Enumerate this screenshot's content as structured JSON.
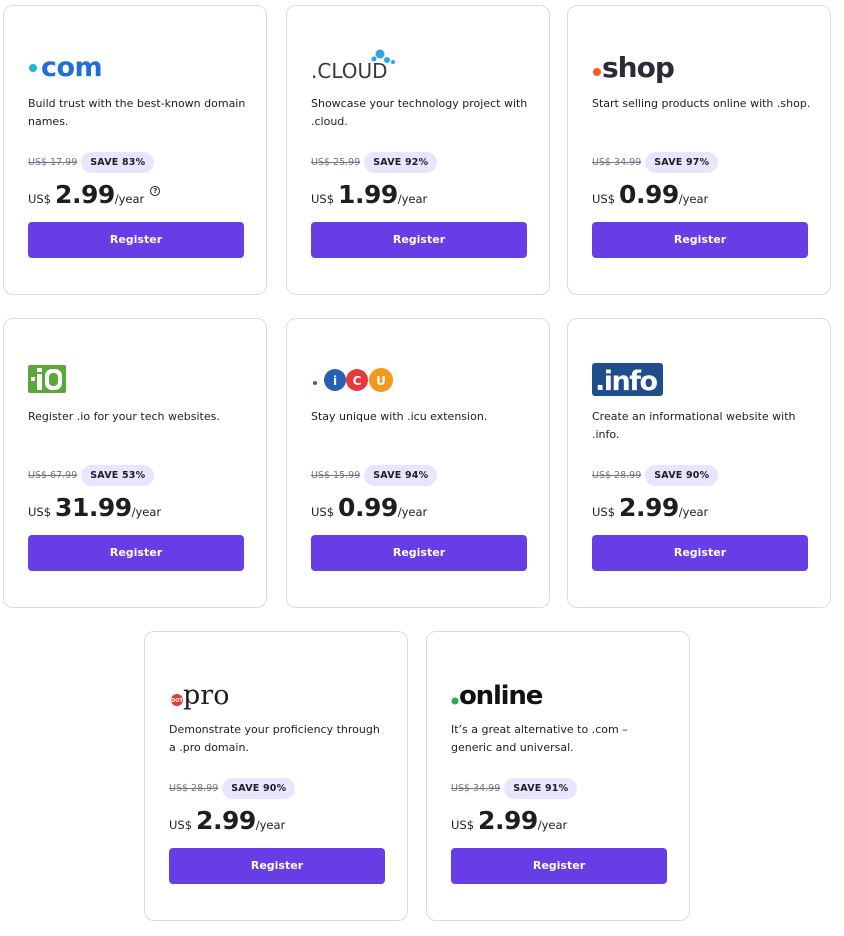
{
  "cards": [
    {
      "logo": "dot-com-logo",
      "logo_text": ".com",
      "description": "Build trust with the best-known domain names.",
      "old_price": "US$ 17.99",
      "save": "SAVE 83%",
      "currency": "US$",
      "price": "2.99",
      "period": "/year",
      "help": "?",
      "button": "Register"
    },
    {
      "logo": "dot-cloud-logo",
      "logo_text": ".CLOUD",
      "description": "Showcase your technology project with .cloud.",
      "old_price": "US$ 25.99",
      "save": "SAVE 92%",
      "currency": "US$",
      "price": "1.99",
      "period": "/year",
      "button": "Register"
    },
    {
      "logo": "dot-shop-logo",
      "logo_text": ".shop",
      "description": "Start selling products online with .shop.",
      "old_price": "US$ 34.99",
      "save": "SAVE 97%",
      "currency": "US$",
      "price": "0.99",
      "period": "/year",
      "button": "Register"
    },
    {
      "logo": "dot-io-logo",
      "logo_text": "·iO",
      "description": "Register .io for your tech websites.",
      "old_price": "US$ 67.99",
      "save": "SAVE 53%",
      "currency": "US$",
      "price": "31.99",
      "period": "/year",
      "button": "Register"
    },
    {
      "logo": "dot-icu-logo",
      "logo_text": "ICU",
      "description": "Stay unique with .icu extension.",
      "old_price": "US$ 15.99",
      "save": "SAVE 94%",
      "currency": "US$",
      "price": "0.99",
      "period": "/year",
      "button": "Register"
    },
    {
      "logo": "dot-info-logo",
      "logo_text": ".info",
      "description": "Create an informational website with .info.",
      "old_price": "US$ 28.99",
      "save": "SAVE 90%",
      "currency": "US$",
      "price": "2.99",
      "period": "/year",
      "button": "Register"
    },
    {
      "logo": "dot-pro-logo",
      "logo_text": "pro",
      "description": "Demonstrate your proficiency through a .pro domain.",
      "old_price": "US$ 28.99",
      "save": "SAVE 90%",
      "currency": "US$",
      "price": "2.99",
      "period": "/year",
      "button": "Register"
    },
    {
      "logo": "dot-online-logo",
      "logo_text": "online",
      "description": "It’s a great alternative to .com – generic and universal.",
      "old_price": "US$ 34.99",
      "save": "SAVE 91%",
      "currency": "US$",
      "price": "2.99",
      "period": "/year",
      "button": "Register"
    }
  ],
  "colors": {
    "primary": "#673de6",
    "save_badge_bg": "#ebe4ff",
    "com_blue": "#1f6fd6",
    "cloud_blue": "#2aa6e6",
    "shop_orange": "#ff5a1f",
    "io_green": "#5aa83a",
    "icu_blue": "#2a5fb8",
    "icu_red": "#e63a3a",
    "icu_orange": "#f39a1e",
    "info_navy": "#1e4e8c",
    "pro_red": "#e63b2e",
    "online_green": "#23b14d"
  }
}
